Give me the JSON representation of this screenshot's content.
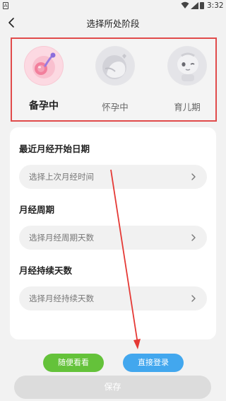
{
  "status_bar": {
    "time": "3:32",
    "notification_icon_label": "A"
  },
  "header": {
    "title": "选择所处阶段"
  },
  "stages": [
    {
      "label": "备孕中",
      "icon": "conception-icon",
      "active": true
    },
    {
      "label": "怀孕中",
      "icon": "pregnancy-icon",
      "active": false
    },
    {
      "label": "育儿期",
      "icon": "baby-icon",
      "active": false
    }
  ],
  "form": {
    "last_period": {
      "label": "最近月经开始日期",
      "placeholder": "选择上次月经时间"
    },
    "cycle": {
      "label": "月经周期",
      "placeholder": "选择月经周期天数"
    },
    "duration": {
      "label": "月经持续天数",
      "placeholder": "选择月经持续天数"
    }
  },
  "buttons": {
    "casual": "随便看看",
    "login": "直接登录",
    "save": "保存"
  },
  "colors": {
    "highlight_border": "#e14b4b",
    "casual_button": "#64c23a",
    "login_button": "#42a7ee",
    "save_button_disabled": "#dcdcdc",
    "annotation_arrow": "#e53935"
  }
}
